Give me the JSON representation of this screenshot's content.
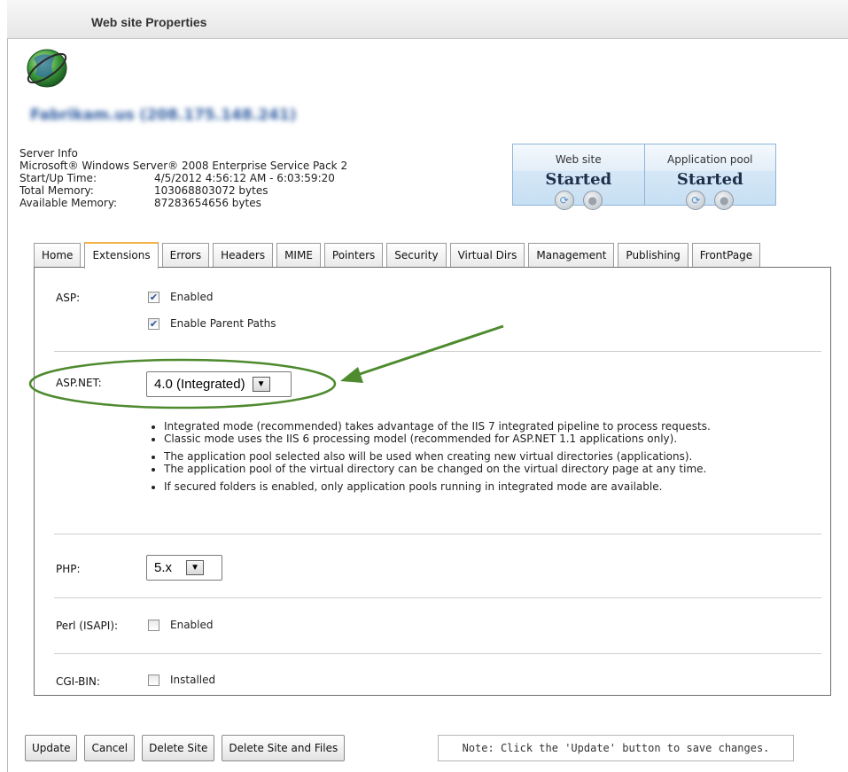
{
  "window": {
    "title": "Web site Properties"
  },
  "site": {
    "name": "Fabrikam.us (208.175.148.241)"
  },
  "server_info": {
    "heading": "Server Info",
    "os": "Microsoft® Windows Server® 2008 Enterprise Service Pack 2",
    "rows": [
      {
        "label": "Start/Up Time:",
        "value": "4/5/2012 4:56:12 AM - 6:03:59:20"
      },
      {
        "label": "Total Memory:",
        "value": "103068803072 bytes"
      },
      {
        "label": "Available Memory:",
        "value": "87283654656 bytes"
      }
    ]
  },
  "status": {
    "website": {
      "label": "Web site",
      "value": "Started"
    },
    "app_pool": {
      "label": "Application pool",
      "value": "Started"
    }
  },
  "tabs": [
    "Home",
    "Extensions",
    "Errors",
    "Headers",
    "MIME",
    "Pointers",
    "Security",
    "Virtual Dirs",
    "Management",
    "Publishing",
    "FrontPage"
  ],
  "active_tab": "Extensions",
  "asp": {
    "label": "ASP:",
    "enabled_label": "Enabled",
    "enabled": true,
    "parent_paths_label": "Enable Parent Paths",
    "parent_paths": true
  },
  "aspnet": {
    "label": "ASP.NET:",
    "selected": "4.0 (Integrated)",
    "notes": [
      [
        "Integrated mode (recommended) takes advantage of the IIS 7 integrated pipeline to process requests.",
        "Classic mode uses the IIS 6 processing model (recommended for ASP.NET 1.1 applications only)."
      ],
      [
        "The application pool selected also will be used when creating new virtual directories (applications).",
        "The application pool of the virtual directory can be changed on the virtual directory page at any time."
      ],
      [
        "If secured folders is enabled, only application pools running in integrated mode are available."
      ]
    ]
  },
  "php": {
    "label": "PHP:",
    "selected": "5.x"
  },
  "perl": {
    "label": "Perl (ISAPI):",
    "checkbox_label": "Enabled",
    "checked": false
  },
  "cgi": {
    "label": "CGI-BIN:",
    "checkbox_label": "Installed",
    "checked": false
  },
  "footer": {
    "buttons": [
      "Update",
      "Cancel",
      "Delete Site",
      "Delete Site and Files"
    ],
    "note": "Note: Click the 'Update' button to save changes."
  },
  "annotation_color": "#4e8a2e"
}
